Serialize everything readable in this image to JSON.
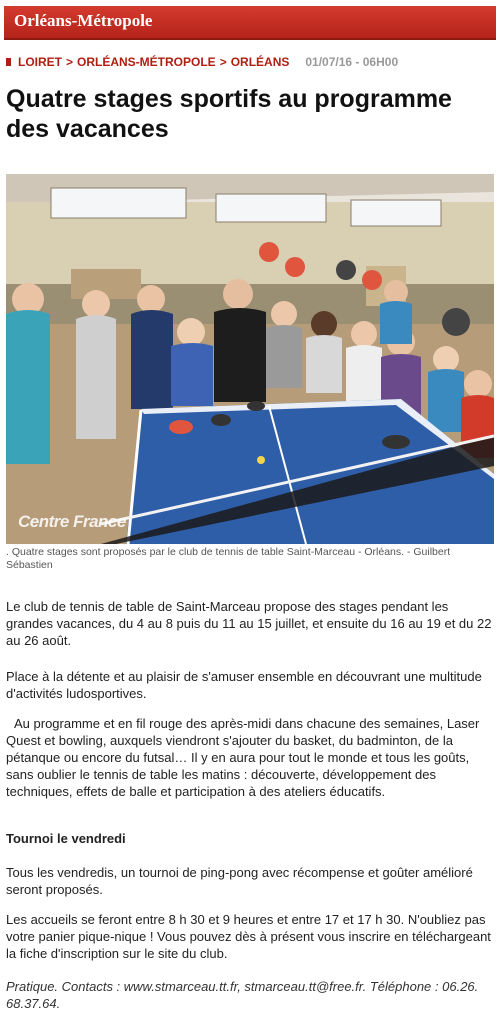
{
  "banner": {
    "title": "Orléans-Métropole"
  },
  "breadcrumb": {
    "items": [
      "LOIRET",
      "ORLÉANS-MÉTROPOLE",
      "ORLÉANS"
    ],
    "separator": ">",
    "date": "01/07/16 - 06H00"
  },
  "article": {
    "headline": "Quatre stages sportifs au programme des vacances",
    "photo": {
      "watermark": "Centre France",
      "caption": ". Quatre stages sont proposés par le club de tennis de table Saint-Marceau - Orléans. - Guilbert Sébastien"
    },
    "paragraphs": [
      "Le club de tennis de table de Saint-Marceau propose des stages pendant les grandes vacances, du 4 au 8 puis du 11 au 15 juillet, et ensuite du 16 au 19 et du 22 au 26 août.",
      "Place à la détente et au plaisir de s'amuser ensemble en découvrant une multitude d'activités ludosportives.",
      "Au programme et en fil rouge des après-midi dans chacune des semaines, Laser Quest et bowling, auxquels viendront s'ajouter du basket, du badminton, de la pétanque ou encore du futsal… Il y en aura pour tout le monde et tous les goûts, sans oublier le tennis de table les matins : découverte, développement des techniques, effets de balle et participation à des ateliers éducatifs.",
      "Tournoi le vendredi",
      "Tous les vendredis, un tournoi de ping-pong avec récompense et goûter amélioré seront proposés.",
      "Les accueils se feront entre 8 h 30 et 9 heures et entre 17 et 17 h 30. N'oubliez pas votre panier pique-nique ! Vous pouvez dès à présent vous inscrire en téléchargeant la fiche d'inscription sur le site du club.",
      "Pratique. Contacts : www.stmarceau.tt.fr, stmarceau.tt@free.fr. Téléphone : 06.26. 68.37.64."
    ]
  },
  "colors": {
    "banner": "#c0281c",
    "accent": "#b01e12",
    "table": "#2f5ea8"
  }
}
